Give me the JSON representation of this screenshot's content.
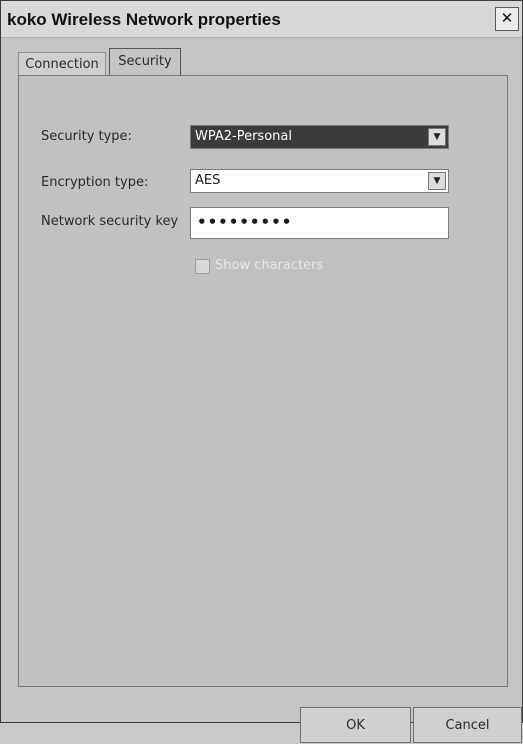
{
  "window": {
    "title": "koko Wireless Network properties",
    "close": "✕"
  },
  "tabs": [
    {
      "label": "Connection"
    },
    {
      "label": "Security"
    }
  ],
  "security": {
    "type_label": "Security type:",
    "type_value": "WPA2-Personal",
    "enc_label": "Encryption type:",
    "enc_value": "AES",
    "key_label": "Network security key",
    "key_value": "•••••••••",
    "show_chars_label": "Show characters",
    "show_chars_checked": false
  },
  "buttons": {
    "ok": "OK",
    "cancel": "Cancel"
  },
  "icons": {
    "dropdown": "dropdown-arrow-icon",
    "close": "close-icon"
  }
}
